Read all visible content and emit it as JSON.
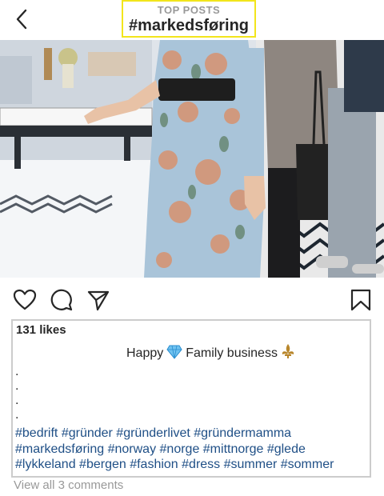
{
  "header": {
    "back_icon": "chevron-left-icon",
    "top_label": "TOP POSTS",
    "title": "#markedsføring"
  },
  "post": {
    "likes": "131 likes",
    "caption_line1_before": "Happy",
    "caption_line1_after": "Family business",
    "caption_emojis": [
      "gem-icon",
      "fleur-de-lis-icon"
    ],
    "dot_lines": [
      ".",
      ".",
      ".",
      "."
    ],
    "hashtags_line1": "#bedrift #gründer #gründerlivet #gründermamma",
    "hashtags_line2": "#markedsføring #norway #norge #mittnorge #glede",
    "hashtags_line3": "#lykkeland #bergen #fashion #dress #summer #sommer",
    "view_comments": "View all 3 comments"
  },
  "actions": {
    "icons": [
      "heart-icon",
      "comment-icon",
      "share-icon",
      "bookmark-icon"
    ]
  },
  "colors": {
    "highlight_border": "#f2e51c",
    "hashtag": "#1f4f86",
    "muted": "#999999",
    "caption_border": "#cccccc"
  }
}
